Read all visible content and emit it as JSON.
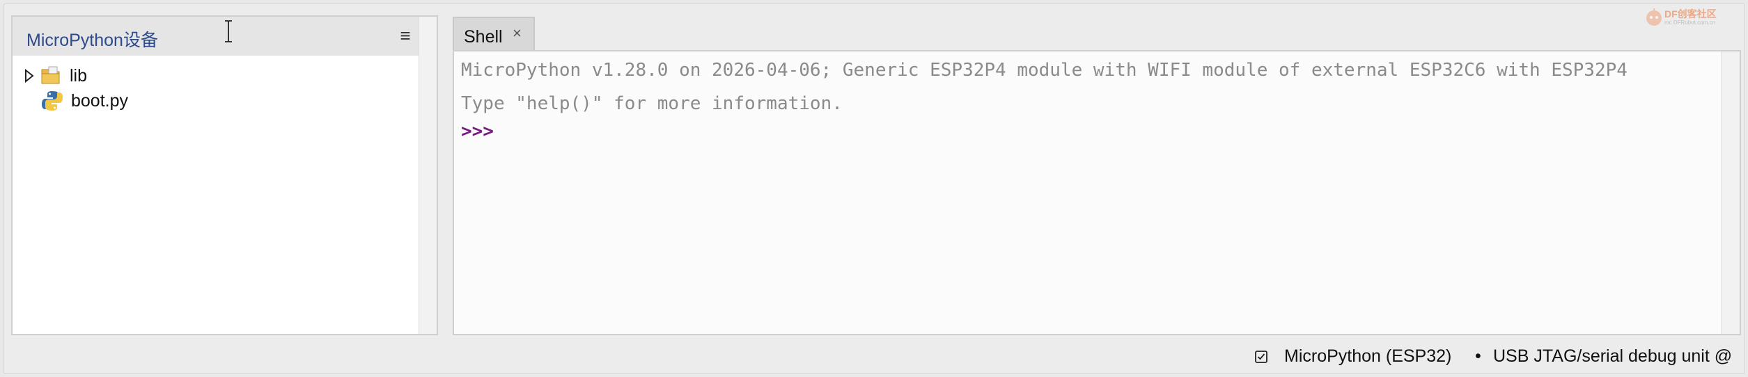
{
  "files_panel": {
    "title": "MicroPython设备",
    "menu_icon": "hamburger-menu-icon",
    "items": [
      {
        "label": "lib",
        "type": "folder",
        "expandable": true,
        "icon": "folder-icon"
      },
      {
        "label": "boot.py",
        "type": "file",
        "expandable": false,
        "icon": "python-file-icon"
      }
    ]
  },
  "shell": {
    "tab_label": "Shell",
    "close_glyph": "×",
    "lines": [
      "MicroPython v1.28.0 on 2026-04-06; Generic ESP32P4 module with WIFI module of external ESP32C6 with ESP32P4",
      "Type \"help()\" for more information."
    ],
    "prompt": ">>>"
  },
  "status_bar": {
    "interpreter": "MicroPython (ESP32)",
    "separator": "•",
    "port": "USB JTAG/serial debug unit @"
  },
  "watermark": {
    "brand": "DF创客社区",
    "sub": "mc.DFRobot.com.cn"
  },
  "colors": {
    "panel_title": "#2c4a8c",
    "shell_output": "#8a8a8a",
    "prompt": "#7a1a86",
    "watermark": "#e8733a"
  }
}
